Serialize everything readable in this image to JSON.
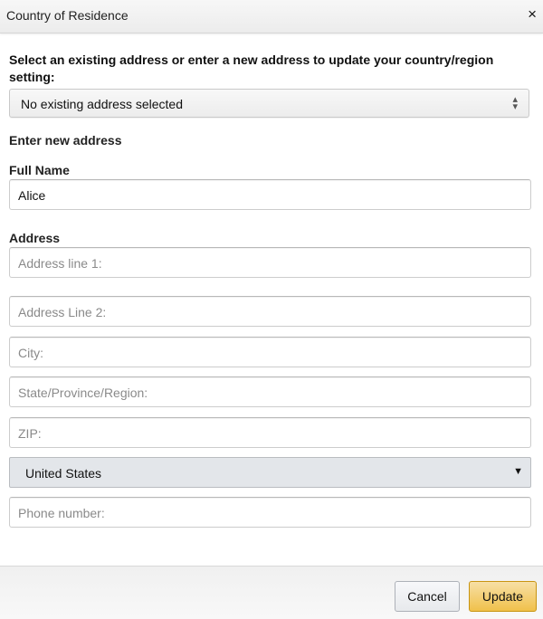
{
  "dialog": {
    "title": "Country of Residence",
    "close_icon": "×"
  },
  "prompt": "Select an existing address or enter a new address to update your country/region setting:",
  "existing_address_select": {
    "selected": "No existing address selected",
    "icon": "⇕"
  },
  "section_heading": "Enter new address",
  "full_name": {
    "label": "Full Name",
    "value": "Alice"
  },
  "address": {
    "label": "Address",
    "line1_placeholder": "Address line 1:",
    "line2_placeholder": "Address Line 2:",
    "city_placeholder": "City:",
    "state_placeholder": "State/Province/Region:",
    "zip_placeholder": "ZIP:",
    "country": "United States",
    "country_arrow": "▼",
    "phone_placeholder": "Phone number:"
  },
  "footer": {
    "cancel_label": "Cancel",
    "update_label": "Update"
  },
  "colors": {
    "update_button": "#f0c14b",
    "country_select_bg": "#e3e6ea"
  }
}
